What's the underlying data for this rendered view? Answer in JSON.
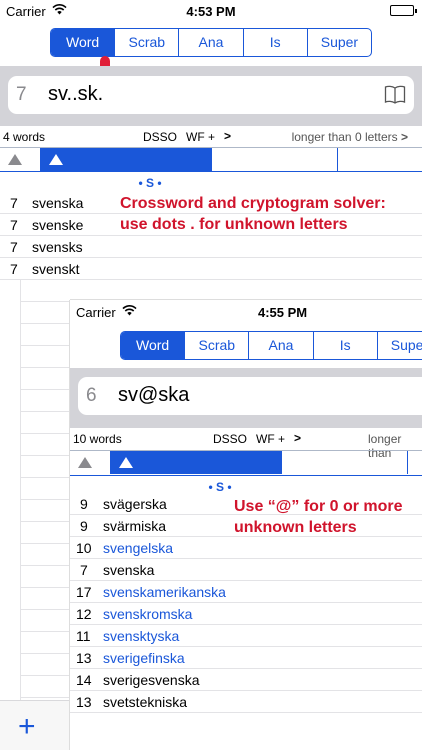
{
  "status": {
    "carrier": "Carrier",
    "time": "4:53 PM"
  },
  "tabs": [
    "Word",
    "Scrab",
    "Ana",
    "Is",
    "Super"
  ],
  "active_tab": "Word",
  "search": {
    "count": "7",
    "pattern": "sv..sk."
  },
  "info": {
    "words": "4 words",
    "dsso": "DSSO",
    "wf": "WF",
    "plus": "+",
    "chevron": ">",
    "longer": "longer than 0 letters",
    "longer_chevron": ">"
  },
  "section_header": "• S •",
  "results": [
    {
      "len": "7",
      "word": "svenska"
    },
    {
      "len": "7",
      "word": "svenske"
    },
    {
      "len": "7",
      "word": "svensks"
    },
    {
      "len": "7",
      "word": "svenskt"
    }
  ],
  "note1": {
    "line1": "Crossword and cryptogram solver:",
    "line2": "use dots . for unknown letters"
  },
  "toolbar": {
    "add": "+"
  },
  "overlay": {
    "status": {
      "carrier": "Carrier",
      "time": "4:55 PM"
    },
    "tabs": [
      "Word",
      "Scrab",
      "Ana",
      "Is",
      "Super"
    ],
    "search": {
      "count": "6",
      "pattern": "sv@ska"
    },
    "info": {
      "words": "10 words",
      "dsso": "DSSO",
      "wf": "WF",
      "plus": "+",
      "chevron": ">",
      "longer": "longer than"
    },
    "section_header": "• S •",
    "results": [
      {
        "len": "9",
        "word": "svägerska",
        "link": false
      },
      {
        "len": "9",
        "word": "svärmiska",
        "link": false
      },
      {
        "len": "10",
        "word": "svengelska",
        "link": true
      },
      {
        "len": "7",
        "word": "svenska",
        "link": false
      },
      {
        "len": "17",
        "word": "svenskamerikanska",
        "link": true
      },
      {
        "len": "12",
        "word": "svenskromska",
        "link": true
      },
      {
        "len": "11",
        "word": "svensktyska",
        "link": true
      },
      {
        "len": "13",
        "word": "sverigefinska",
        "link": true
      },
      {
        "len": "14",
        "word": "sverigesvenska",
        "link": false
      },
      {
        "len": "13",
        "word": "svetstekniska",
        "link": false
      }
    ],
    "note": {
      "line1": "Use “@” for 0 or more",
      "line2": "unknown letters"
    }
  },
  "colors": {
    "accent": "#1a57d9",
    "note": "#d0142c",
    "band": "#d3d3d8"
  },
  "icons": [
    "wifi-icon",
    "battery-icon",
    "book-icon",
    "sort-up-icon",
    "plus-icon",
    "tap-cursor-icon"
  ]
}
